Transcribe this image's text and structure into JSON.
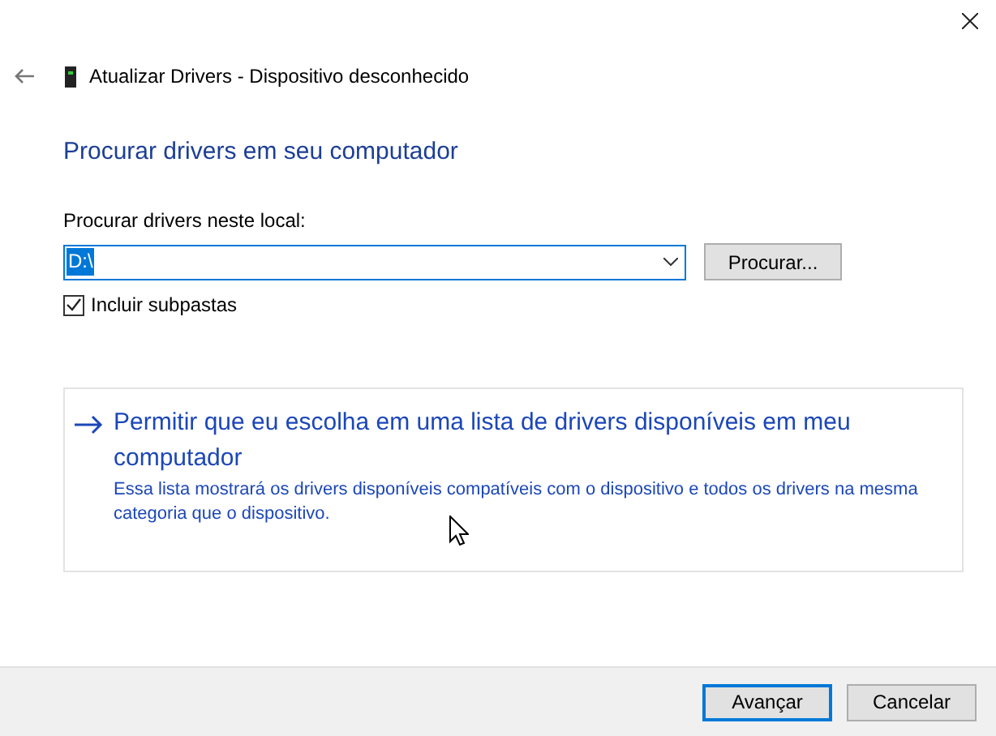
{
  "window": {
    "title": "Atualizar Drivers - Dispositivo desconhecido"
  },
  "heading": "Procurar drivers em seu computador",
  "location": {
    "label": "Procurar drivers neste local:",
    "value": "D:\\",
    "value_selected": true,
    "browse_button": "Procurar..."
  },
  "include_subfolders": {
    "label": "Incluir subpastas",
    "checked": true
  },
  "option": {
    "title": "Permitir que eu escolha em uma lista de drivers disponíveis em meu computador",
    "description": "Essa lista mostrará os drivers disponíveis compatíveis com o dispositivo e todos os drivers na mesma categoria que o dispositivo."
  },
  "buttons": [
    {
      "label": "Avançar",
      "default": true
    },
    {
      "label": "Cancelar",
      "default": false
    }
  ]
}
